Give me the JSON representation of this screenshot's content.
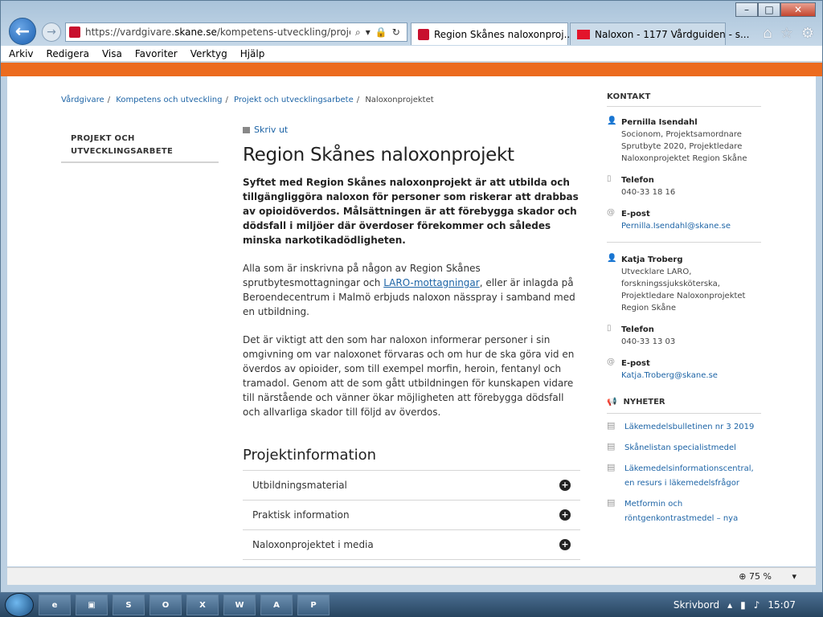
{
  "browser": {
    "address_base": "https://vardgivare.",
    "address_domain": "skane.se",
    "address_path": "/kompetens-utveckling/projekt-och",
    "tabs": [
      {
        "label": "Region Skånes naloxonproj..."
      },
      {
        "label": "Naloxon - 1177 Vårdguiden - s..."
      }
    ],
    "menu": [
      "Arkiv",
      "Redigera",
      "Visa",
      "Favoriter",
      "Verktyg",
      "Hjälp"
    ]
  },
  "breadcrumb": [
    "Vårdgivare",
    "Kompetens och utveckling",
    "Projekt och utvecklingsarbete",
    "Naloxonprojektet"
  ],
  "leftnav": {
    "title_line1": "PROJEKT OCH",
    "title_line2": "UTVECKLINGSARBETE"
  },
  "main": {
    "print_label": "Skriv ut",
    "title": "Region Skånes naloxonprojekt",
    "lead": "Syftet med Region Skånes naloxonprojekt är att utbilda och tillgängliggöra naloxon för personer som riskerar att drabbas av opioidöverdos. Målsättningen är att förebygga skador och dödsfall i miljöer där överdoser förekommer och således minska narkotikadödligheten.",
    "p1_before": "Alla som är inskrivna på någon av Region Skånes sprutbytesmottagningar och ",
    "p1_link": "LARO-mottagningar",
    "p1_after": ", eller är inlagda på Beroendecentrum i Malmö erbjuds naloxon nässpray i samband med en utbildning.",
    "p2": "Det är viktigt att den som har naloxon informerar personer i sin omgivning om var naloxonet förvaras och om hur de ska göra vid en överdos av opioider, som till exempel morfin, heroin, fentanyl och tramadol. Genom att de som gått utbildningen för kunskapen vidare till närstående och vänner ökar möjligheten att förebygga dödsfall och allvarliga skador till följd av överdos.",
    "section_title": "Projektinformation",
    "accordion": [
      "Utbildningsmaterial",
      "Praktisk information",
      "Naloxonprojektet i media"
    ]
  },
  "sidebar": {
    "contact_heading": "KONTAKT",
    "contacts": [
      {
        "name": "Pernilla Isendahl",
        "role": "Socionom, Projektsamordnare Sprutbyte 2020, Projektledare Naloxonprojektet Region Skåne",
        "phone_label": "Telefon",
        "phone": "040-33 18 16",
        "email_label": "E-post",
        "email": "Pernilla.Isendahl@skane.se"
      },
      {
        "name": "Katja Troberg",
        "role": "Utvecklare LARO, forskningssjuksköterska, Projektledare Naloxonprojektet Region Skåne",
        "phone_label": "Telefon",
        "phone": "040-33 13 03",
        "email_label": "E-post",
        "email": "Katja.Troberg@skane.se"
      }
    ],
    "news_heading": "NYHETER",
    "news": [
      "Läkemedelsbulletinen nr 3 2019",
      "Skånelistan specialistmedel",
      "Läkemedelsinformationscentral, en resurs i läkemedelsfrågor",
      "Metformin och röntgenkontrastmedel – nya"
    ]
  },
  "status": {
    "zoom": "75 %"
  },
  "taskbar": {
    "desktop_label": "Skrivbord",
    "time": "15:07"
  }
}
